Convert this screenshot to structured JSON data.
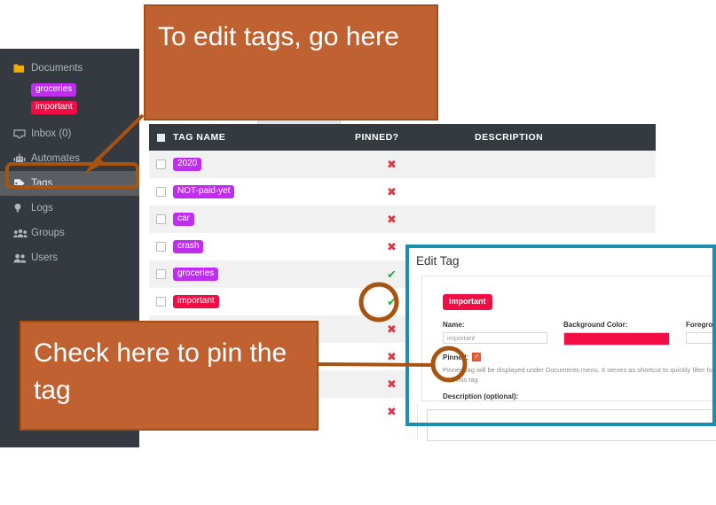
{
  "sidebar": {
    "items": [
      {
        "label": "Documents",
        "icon": "folder-icon",
        "active": false
      },
      {
        "label": "Inbox (0)",
        "icon": "inbox-icon",
        "active": false
      },
      {
        "label": "Automates",
        "icon": "robot-icon",
        "active": false
      },
      {
        "label": "Tags",
        "icon": "tag-icon",
        "active": true
      },
      {
        "label": "Logs",
        "icon": "bulb-icon",
        "active": false
      },
      {
        "label": "Groups",
        "icon": "groups-icon",
        "active": false
      },
      {
        "label": "Users",
        "icon": "users-icon",
        "active": false
      }
    ],
    "pinned_tags": [
      {
        "label": "groceries",
        "color": "#c02df0"
      },
      {
        "label": "important",
        "color": "#f20d45"
      }
    ],
    "background": "#343a40",
    "active_background": "#5a5e63"
  },
  "table": {
    "columns": [
      "TAG NAME",
      "PINNED?",
      "DESCRIPTION"
    ],
    "select_all_checkbox": true,
    "rows": [
      {
        "name": "2020",
        "color": "#c02df0",
        "pinned": false,
        "description": ""
      },
      {
        "name": "NOT-paid-yet",
        "color": "#c02df0",
        "pinned": false,
        "description": ""
      },
      {
        "name": "car",
        "color": "#c02df0",
        "pinned": false,
        "description": ""
      },
      {
        "name": "crash",
        "color": "#c02df0",
        "pinned": false,
        "description": ""
      },
      {
        "name": "groceries",
        "color": "#c02df0",
        "pinned": true,
        "description": ""
      },
      {
        "name": "important",
        "color": "#f20d45",
        "pinned": true,
        "description": ""
      },
      {
        "name": "",
        "color": "#c02df0",
        "pinned": false,
        "description": ""
      },
      {
        "name": "",
        "color": "#c02df0",
        "pinned": false,
        "description": ""
      },
      {
        "name": "",
        "color": "#c02df0",
        "pinned": false,
        "description": ""
      },
      {
        "name": "",
        "color": "#c02df0",
        "pinned": false,
        "description": ""
      }
    ],
    "pinned_yes_glyph": "✔",
    "pinned_no_glyph": "✖",
    "yes_color": "#28a745",
    "no_color": "#dc3545"
  },
  "edit_panel": {
    "title": "Edit Tag",
    "tag_preview": "important",
    "tag_preview_color": "#f20d45",
    "name_label": "Name:",
    "name_value": "important",
    "background_color_label": "Background Color:",
    "background_color_value": "#f20d45",
    "foreground_color_label": "Foreground Color:",
    "foreground_color_value": "",
    "pinned_label": "Pinned:",
    "pinned_checked": true,
    "pinned_helper": "Pinned tag will be displayed under Documents menu. It serves as shortcut to quickly filter folders associated with this tag",
    "description_label": "Description (optional):",
    "description_value": "",
    "highlight_color": "#1a8fb0"
  },
  "annotations": {
    "callout1": "To edit tags, go here",
    "callout2": "Check here to pin the tag",
    "box_fill": "#bf6130",
    "box_border": "#a84e12",
    "line_color": "#a8530f"
  }
}
